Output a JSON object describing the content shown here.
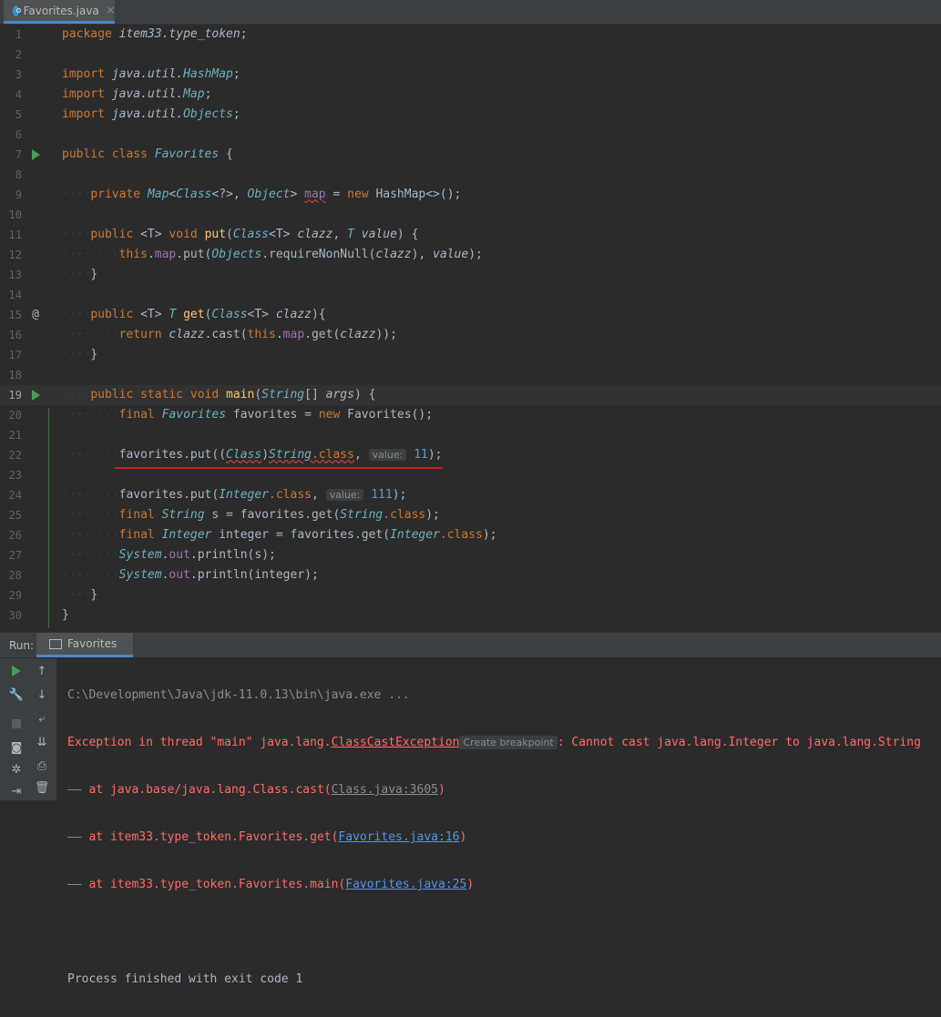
{
  "tab": {
    "filename": "Favorites.java",
    "close_glyph": "✕"
  },
  "editor": {
    "lines": {
      "l1": {
        "kw": "package",
        "pkg": "item33.type_token",
        "end": ";"
      },
      "l3": {
        "kw": "import",
        "pkg": "java.util.",
        "cls": "HashMap",
        "end": ";"
      },
      "l4": {
        "kw": "import",
        "pkg": "java.util.",
        "cls": "Map",
        "end": ";"
      },
      "l5": {
        "kw": "import",
        "pkg": "java.util.",
        "cls": "Objects",
        "end": ";"
      },
      "l7": {
        "kw": "public class",
        "cls": "Favorites",
        "end": "{"
      },
      "l9": {
        "kw": "private",
        "t1": "Map",
        "t2": "Class",
        "t3": "<?>,",
        "t4": "Object",
        "t5": ">",
        "field": "map",
        "eq": "=",
        "kw2": "new",
        "t6": "HashMap<>();"
      },
      "l11": {
        "kw": "public",
        "g": "<T>",
        "kw2": "void",
        "fn": "put",
        "p1": "(",
        "t1": "Class",
        "g2": "<T>",
        "par1": "clazz",
        "c": ",",
        "t2": "T",
        "par2": "value",
        "end": ") {"
      },
      "l12": {
        "kw": "this",
        "dot": ".",
        "field": "map",
        "m": ".put(",
        "cls": "Objects",
        "fn": ".requireNonNull",
        "p1": "(",
        "par1": "clazz",
        "c": "),",
        "par2": "value",
        "end": ");"
      },
      "l13": {
        "end": "}"
      },
      "l15": {
        "kw": "public",
        "g": "<T>",
        "t": "T",
        "fn": "get",
        "p1": "(",
        "t1": "Class",
        "g2": "<T>",
        "par": "clazz",
        "end": "){"
      },
      "l16": {
        "kw": "return",
        "par": "clazz",
        "m": ".cast(",
        "kw2": "this",
        "dot": ".",
        "field": "map",
        "m2": ".get(",
        "par2": "clazz",
        "end": "));"
      },
      "l17": {
        "end": "}"
      },
      "l19": {
        "kw": "public static",
        "kw2": "void",
        "fn": "main",
        "p1": "(",
        "t": "String",
        "arr": "[]",
        "par": "args",
        "end": ") {"
      },
      "l20": {
        "kw": "final",
        "cls": "Favorites",
        "var": "favorites",
        "eq": "=",
        "kw2": "new",
        "t": "Favorites();"
      },
      "l22": {
        "var": "favorites",
        "m": ".put((",
        "cls": "Class",
        "p2": ")",
        "cls2": "String",
        "kw": ".class",
        "c": ",",
        "hint": "value:",
        "num": "11",
        "end": ");"
      },
      "l24": {
        "var": "favorites",
        "m": ".put(",
        "cls": "Integer",
        "kw": ".class",
        "c": ",",
        "hint": "value:",
        "num": "111",
        "end": ");"
      },
      "l25": {
        "kw": "final",
        "cls": "String",
        "var": "s",
        "eq": "=",
        "var2": "favorites",
        "m": ".get(",
        "cls2": "String",
        "kw2": ".class",
        "end": ");"
      },
      "l26": {
        "kw": "final",
        "cls": "Integer",
        "var": "integer",
        "eq": "=",
        "var2": "favorites",
        "m": ".get(",
        "cls2": "Integer",
        "kw2": ".class",
        "end": ");"
      },
      "l27": {
        "cls": "System",
        "dot": ".",
        "field": "out",
        "m": ".println(",
        "var": "s",
        "end": ");"
      },
      "l28": {
        "cls": "System",
        "dot": ".",
        "field": "out",
        "m": ".println(",
        "var": "integer",
        "end": ");"
      },
      "l29": {
        "end": "}"
      },
      "l30": {
        "end": "}"
      }
    },
    "gutter": {
      "at_glyph": "@"
    }
  },
  "run": {
    "label": "Run:",
    "tab_label": "Favorites",
    "console": {
      "cmd": "C:\\Development\\Java\\jdk-11.0.13\\bin\\java.exe ...",
      "exc_prefix": "Exception in thread \"main\" java.lang.",
      "exc_class": "ClassCastException",
      "create_bp": "Create breakpoint",
      "exc_msg": ": Cannot cast java.lang.Integer to java.lang.String",
      "t1_pre": "at java.base/java.lang.Class.cast(",
      "t1_link": "Class.java:3605",
      "t2_pre": "at item33.type_token.Favorites.get(",
      "t2_link": "Favorites.java:16",
      "t3_pre": "at item33.type_token.Favorites.main(",
      "t3_link": "Favorites.java:25",
      "close_paren": ")",
      "exit": "Process finished with exit code 1"
    }
  }
}
